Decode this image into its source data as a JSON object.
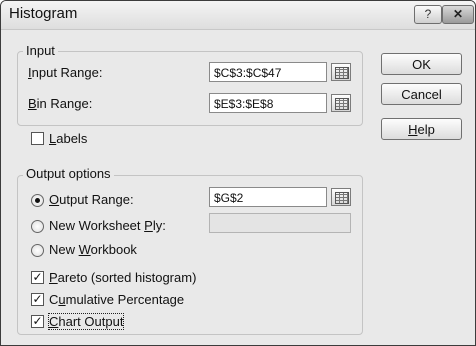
{
  "window": {
    "title": "Histogram",
    "help_glyph": "?",
    "close_glyph": "✕"
  },
  "input_group": {
    "label": "Input",
    "input_range_label": {
      "accel": "I",
      "rest": "nput Range:"
    },
    "input_range_value": "$C$3:$C$47",
    "bin_range_label": {
      "accel": "B",
      "rest": "in Range:"
    },
    "bin_range_value": "$E$3:$E$8"
  },
  "labels_checkbox": {
    "accel": "L",
    "rest": "abels",
    "checked": false
  },
  "output_group": {
    "label": "Output options",
    "output_range": {
      "accel": "O",
      "rest": "utput Range:",
      "value": "$G$2",
      "selected": true
    },
    "new_worksheet_ply": {
      "pre": "New Worksheet ",
      "accel": "P",
      "rest": "ly:",
      "value": "",
      "selected": false
    },
    "new_workbook": {
      "pre": "New ",
      "accel": "W",
      "rest": "orkbook",
      "selected": false
    },
    "pareto": {
      "pre": "",
      "accel": "P",
      "rest": "areto (sorted histogram)",
      "checked": true,
      "mark": "✓"
    },
    "cumulative": {
      "pre": "C",
      "accel": "u",
      "rest": "mulative Percentage",
      "checked": true,
      "mark": "✓"
    },
    "chart_output": {
      "pre": "",
      "accel": "C",
      "rest": "hart Output",
      "checked": true,
      "mark": "✓"
    }
  },
  "buttons": {
    "ok": "OK",
    "cancel": "Cancel",
    "help": {
      "accel": "H",
      "rest": "elp"
    }
  }
}
